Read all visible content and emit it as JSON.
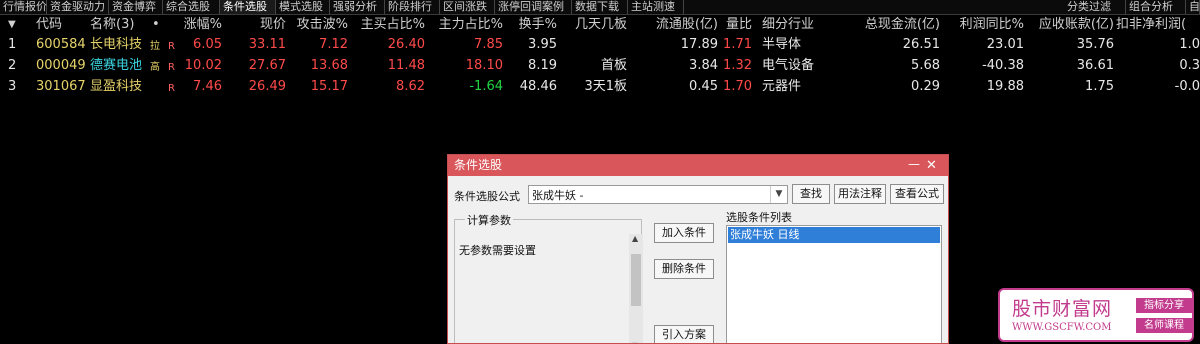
{
  "tabs": [
    "行情报价",
    "资金驱动力",
    "资金博弈",
    "综合选股",
    "条件选股",
    "模式选股",
    "强弱分析",
    "阶段排行",
    "区间涨跌",
    "涨停回调案例",
    "数据下载",
    "主站测速"
  ],
  "right_tabs": [
    "分类过滤",
    "组合分析",
    "自"
  ],
  "table": {
    "sort_icon": "▼",
    "dot_label": "•",
    "headers": {
      "code": "代码",
      "name": "名称(3)",
      "pct": "涨幅%",
      "price": "现价",
      "wave": "攻击波%",
      "buy_ratio": "主买占比%",
      "main_ratio": "主力占比%",
      "turnover": "换手%",
      "boards": "几天几板",
      "float": "流通股(亿)",
      "vol_ratio": "量比",
      "industry": "细分行业",
      "cash": "总现金流(亿)",
      "profit": "利润同比%",
      "receivable": "应收账款(亿)",
      "deduct": "扣非净利润("
    },
    "rows": [
      {
        "idx": "1",
        "code": "600584",
        "name": "长电科技",
        "mark": "拉",
        "r": "R",
        "pct": "6.05",
        "price": "33.11",
        "wave": "7.12",
        "buy_ratio": "26.40",
        "main_ratio": "7.85",
        "turnover": "3.95",
        "boards": "",
        "float": "17.89",
        "vol_ratio": "1.71",
        "industry": "半导体",
        "cash": "26.51",
        "profit": "23.01",
        "receivable": "35.76",
        "deduct": "1.0"
      },
      {
        "idx": "2",
        "code": "000049",
        "name": "德赛电池",
        "mark": "高",
        "r": "R",
        "pct": "10.02",
        "price": "27.67",
        "wave": "13.68",
        "buy_ratio": "11.48",
        "main_ratio": "18.10",
        "turnover": "8.19",
        "boards": "首板",
        "float": "3.84",
        "vol_ratio": "1.32",
        "industry": "电气设备",
        "cash": "5.68",
        "profit": "-40.38",
        "receivable": "36.61",
        "deduct": "0.3"
      },
      {
        "idx": "3",
        "code": "301067",
        "name": "显盈科技",
        "mark": "",
        "r": "R",
        "pct": "7.46",
        "price": "26.49",
        "wave": "15.17",
        "buy_ratio": "8.62",
        "main_ratio": "-1.64",
        "turnover": "48.46",
        "boards": "3天1板",
        "float": "0.45",
        "vol_ratio": "1.70",
        "industry": "元器件",
        "cash": "0.29",
        "profit": "19.88",
        "receivable": "1.75",
        "deduct": "-0.0"
      }
    ]
  },
  "dialog": {
    "title": "条件选股",
    "min_icon": "—",
    "close_icon": "✕",
    "formula_label": "条件选股公式",
    "formula_value": "张成牛妖  -",
    "combo_arrow": "▼",
    "btn_find": "查找",
    "btn_usage": "用法注释",
    "btn_view": "查看公式",
    "params_title": "计算参数",
    "params_text": "无参数需要设置",
    "btn_add": "加入条件",
    "btn_delete": "删除条件",
    "btn_import": "引入方案",
    "list_title": "选股条件列表",
    "list_items": [
      "张成牛妖  日线"
    ],
    "scroll_up": "▲",
    "scroll_down": "▼"
  },
  "watermark": {
    "title": "股市财富网",
    "url": "WWW.GSCFW.COM",
    "tag1": "指标分享",
    "tag2": "名师课程"
  }
}
